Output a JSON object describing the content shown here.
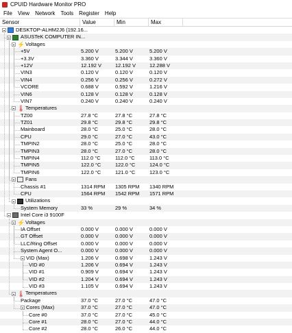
{
  "window": {
    "title": "CPUID Hardware Monitor PRO"
  },
  "menu": [
    "File",
    "View",
    "Network",
    "Tools",
    "Register",
    "Help"
  ],
  "columns": {
    "sensor": "Sensor",
    "value": "Value",
    "min": "Min",
    "max": "Max"
  },
  "rows": [
    {
      "label": "DESKTOP-ALHM2J6 (192.16...",
      "level": 0,
      "icon": "computer-icon",
      "expand": true
    },
    {
      "label": "ASUSTeK COMPUTER IN...",
      "level": 1,
      "icon": "motherboard-icon",
      "expand": true
    },
    {
      "label": "Voltages",
      "level": 2,
      "icon": "voltage-icon",
      "expand": true
    },
    {
      "label": "+5V",
      "level": 3,
      "value": "5.200 V",
      "min": "5.200 V",
      "max": "5.200 V"
    },
    {
      "label": "+3.3V",
      "level": 3,
      "value": "3.360 V",
      "min": "3.344 V",
      "max": "3.360 V"
    },
    {
      "label": "+12V",
      "level": 3,
      "value": "12.192 V",
      "min": "12.192 V",
      "max": "12.288 V"
    },
    {
      "label": "VIN3",
      "level": 3,
      "value": "0.120 V",
      "min": "0.120 V",
      "max": "0.120 V"
    },
    {
      "label": "VIN4",
      "level": 3,
      "value": "0.256 V",
      "min": "0.256 V",
      "max": "0.272 V"
    },
    {
      "label": "VCORE",
      "level": 3,
      "value": "0.688 V",
      "min": "0.592 V",
      "max": "1.216 V"
    },
    {
      "label": "VIN6",
      "level": 3,
      "value": "0.128 V",
      "min": "0.128 V",
      "max": "0.128 V"
    },
    {
      "label": "VIN7",
      "level": 3,
      "value": "0.240 V",
      "min": "0.240 V",
      "max": "0.240 V"
    },
    {
      "label": "Temperatures",
      "level": 2,
      "icon": "thermometer-icon",
      "expand": true
    },
    {
      "label": "TZ00",
      "level": 3,
      "value": "27.8 °C",
      "min": "27.8 °C",
      "max": "27.8 °C"
    },
    {
      "label": "TZ01",
      "level": 3,
      "value": "29.8 °C",
      "min": "29.8 °C",
      "max": "29.8 °C"
    },
    {
      "label": "Mainboard",
      "level": 3,
      "value": "28.0 °C",
      "min": "25.0 °C",
      "max": "28.0 °C"
    },
    {
      "label": "CPU",
      "level": 3,
      "value": "29.0 °C",
      "min": "27.0 °C",
      "max": "43.0 °C"
    },
    {
      "label": "TMPIN2",
      "level": 3,
      "value": "28.0 °C",
      "min": "25.0 °C",
      "max": "28.0 °C"
    },
    {
      "label": "TMPIN3",
      "level": 3,
      "value": "28.0 °C",
      "min": "27.0 °C",
      "max": "28.0 °C"
    },
    {
      "label": "TMPIN4",
      "level": 3,
      "value": "112.0 °C",
      "min": "112.0 °C",
      "max": "113.0 °C"
    },
    {
      "label": "TMPIN5",
      "level": 3,
      "value": "122.0 °C",
      "min": "122.0 °C",
      "max": "124.0 °C"
    },
    {
      "label": "TMPIN6",
      "level": 3,
      "value": "122.0 °C",
      "min": "121.0 °C",
      "max": "123.0 °C"
    },
    {
      "label": "Fans",
      "level": 2,
      "icon": "fan-icon",
      "expand": true
    },
    {
      "label": "Chassis #1",
      "level": 3,
      "value": "1314 RPM",
      "min": "1305 RPM",
      "max": "1340 RPM"
    },
    {
      "label": "CPU",
      "level": 3,
      "value": "1564 RPM",
      "min": "1542 RPM",
      "max": "1571 RPM"
    },
    {
      "label": "Utilizations",
      "level": 2,
      "icon": "utilization-icon",
      "expand": true
    },
    {
      "label": "System Memory",
      "level": 3,
      "value": "33 %",
      "min": "29 %",
      "max": "34 %"
    },
    {
      "label": "Intel Core i3 9100F",
      "level": 1,
      "icon": "cpu-icon",
      "expand": true
    },
    {
      "label": "Voltages",
      "level": 2,
      "icon": "voltage-icon",
      "expand": true
    },
    {
      "label": "IA Offset",
      "level": 3,
      "value": "0.000 V",
      "min": "0.000 V",
      "max": "0.000 V"
    },
    {
      "label": "GT Offset",
      "level": 3,
      "value": "0.000 V",
      "min": "0.000 V",
      "max": "0.000 V"
    },
    {
      "label": "LLC/Ring Offset",
      "level": 3,
      "value": "0.000 V",
      "min": "0.000 V",
      "max": "0.000 V"
    },
    {
      "label": "System Agent O...",
      "level": 3,
      "value": "0.000 V",
      "min": "0.000 V",
      "max": "0.000 V"
    },
    {
      "label": "VID (Max)",
      "level": 3,
      "value": "1.206 V",
      "min": "0.698 V",
      "max": "1.243 V",
      "expand": true
    },
    {
      "label": "VID #0",
      "level": 4,
      "value": "1.206 V",
      "min": "0.694 V",
      "max": "1.243 V"
    },
    {
      "label": "VID #1",
      "level": 4,
      "value": "0.909 V",
      "min": "0.694 V",
      "max": "1.243 V"
    },
    {
      "label": "VID #2",
      "level": 4,
      "value": "1.204 V",
      "min": "0.694 V",
      "max": "1.243 V"
    },
    {
      "label": "VID #3",
      "level": 4,
      "value": "1.105 V",
      "min": "0.694 V",
      "max": "1.243 V"
    },
    {
      "label": "Temperatures",
      "level": 2,
      "icon": "thermometer-icon",
      "expand": true
    },
    {
      "label": "Package",
      "level": 3,
      "value": "37.0 °C",
      "min": "27.0 °C",
      "max": "47.0 °C"
    },
    {
      "label": "Cores (Max)",
      "level": 3,
      "value": "37.0 °C",
      "min": "27.0 °C",
      "max": "47.0 °C",
      "expand": true
    },
    {
      "label": "Core #0",
      "level": 4,
      "value": "37.0 °C",
      "min": "27.0 °C",
      "max": "45.0 °C"
    },
    {
      "label": "Core #1",
      "level": 4,
      "value": "28.0 °C",
      "min": "27.0 °C",
      "max": "44.0 °C"
    },
    {
      "label": "Core #2",
      "level": 4,
      "value": "28.0 °C",
      "min": "26.0 °C",
      "max": "44.0 °C"
    }
  ]
}
